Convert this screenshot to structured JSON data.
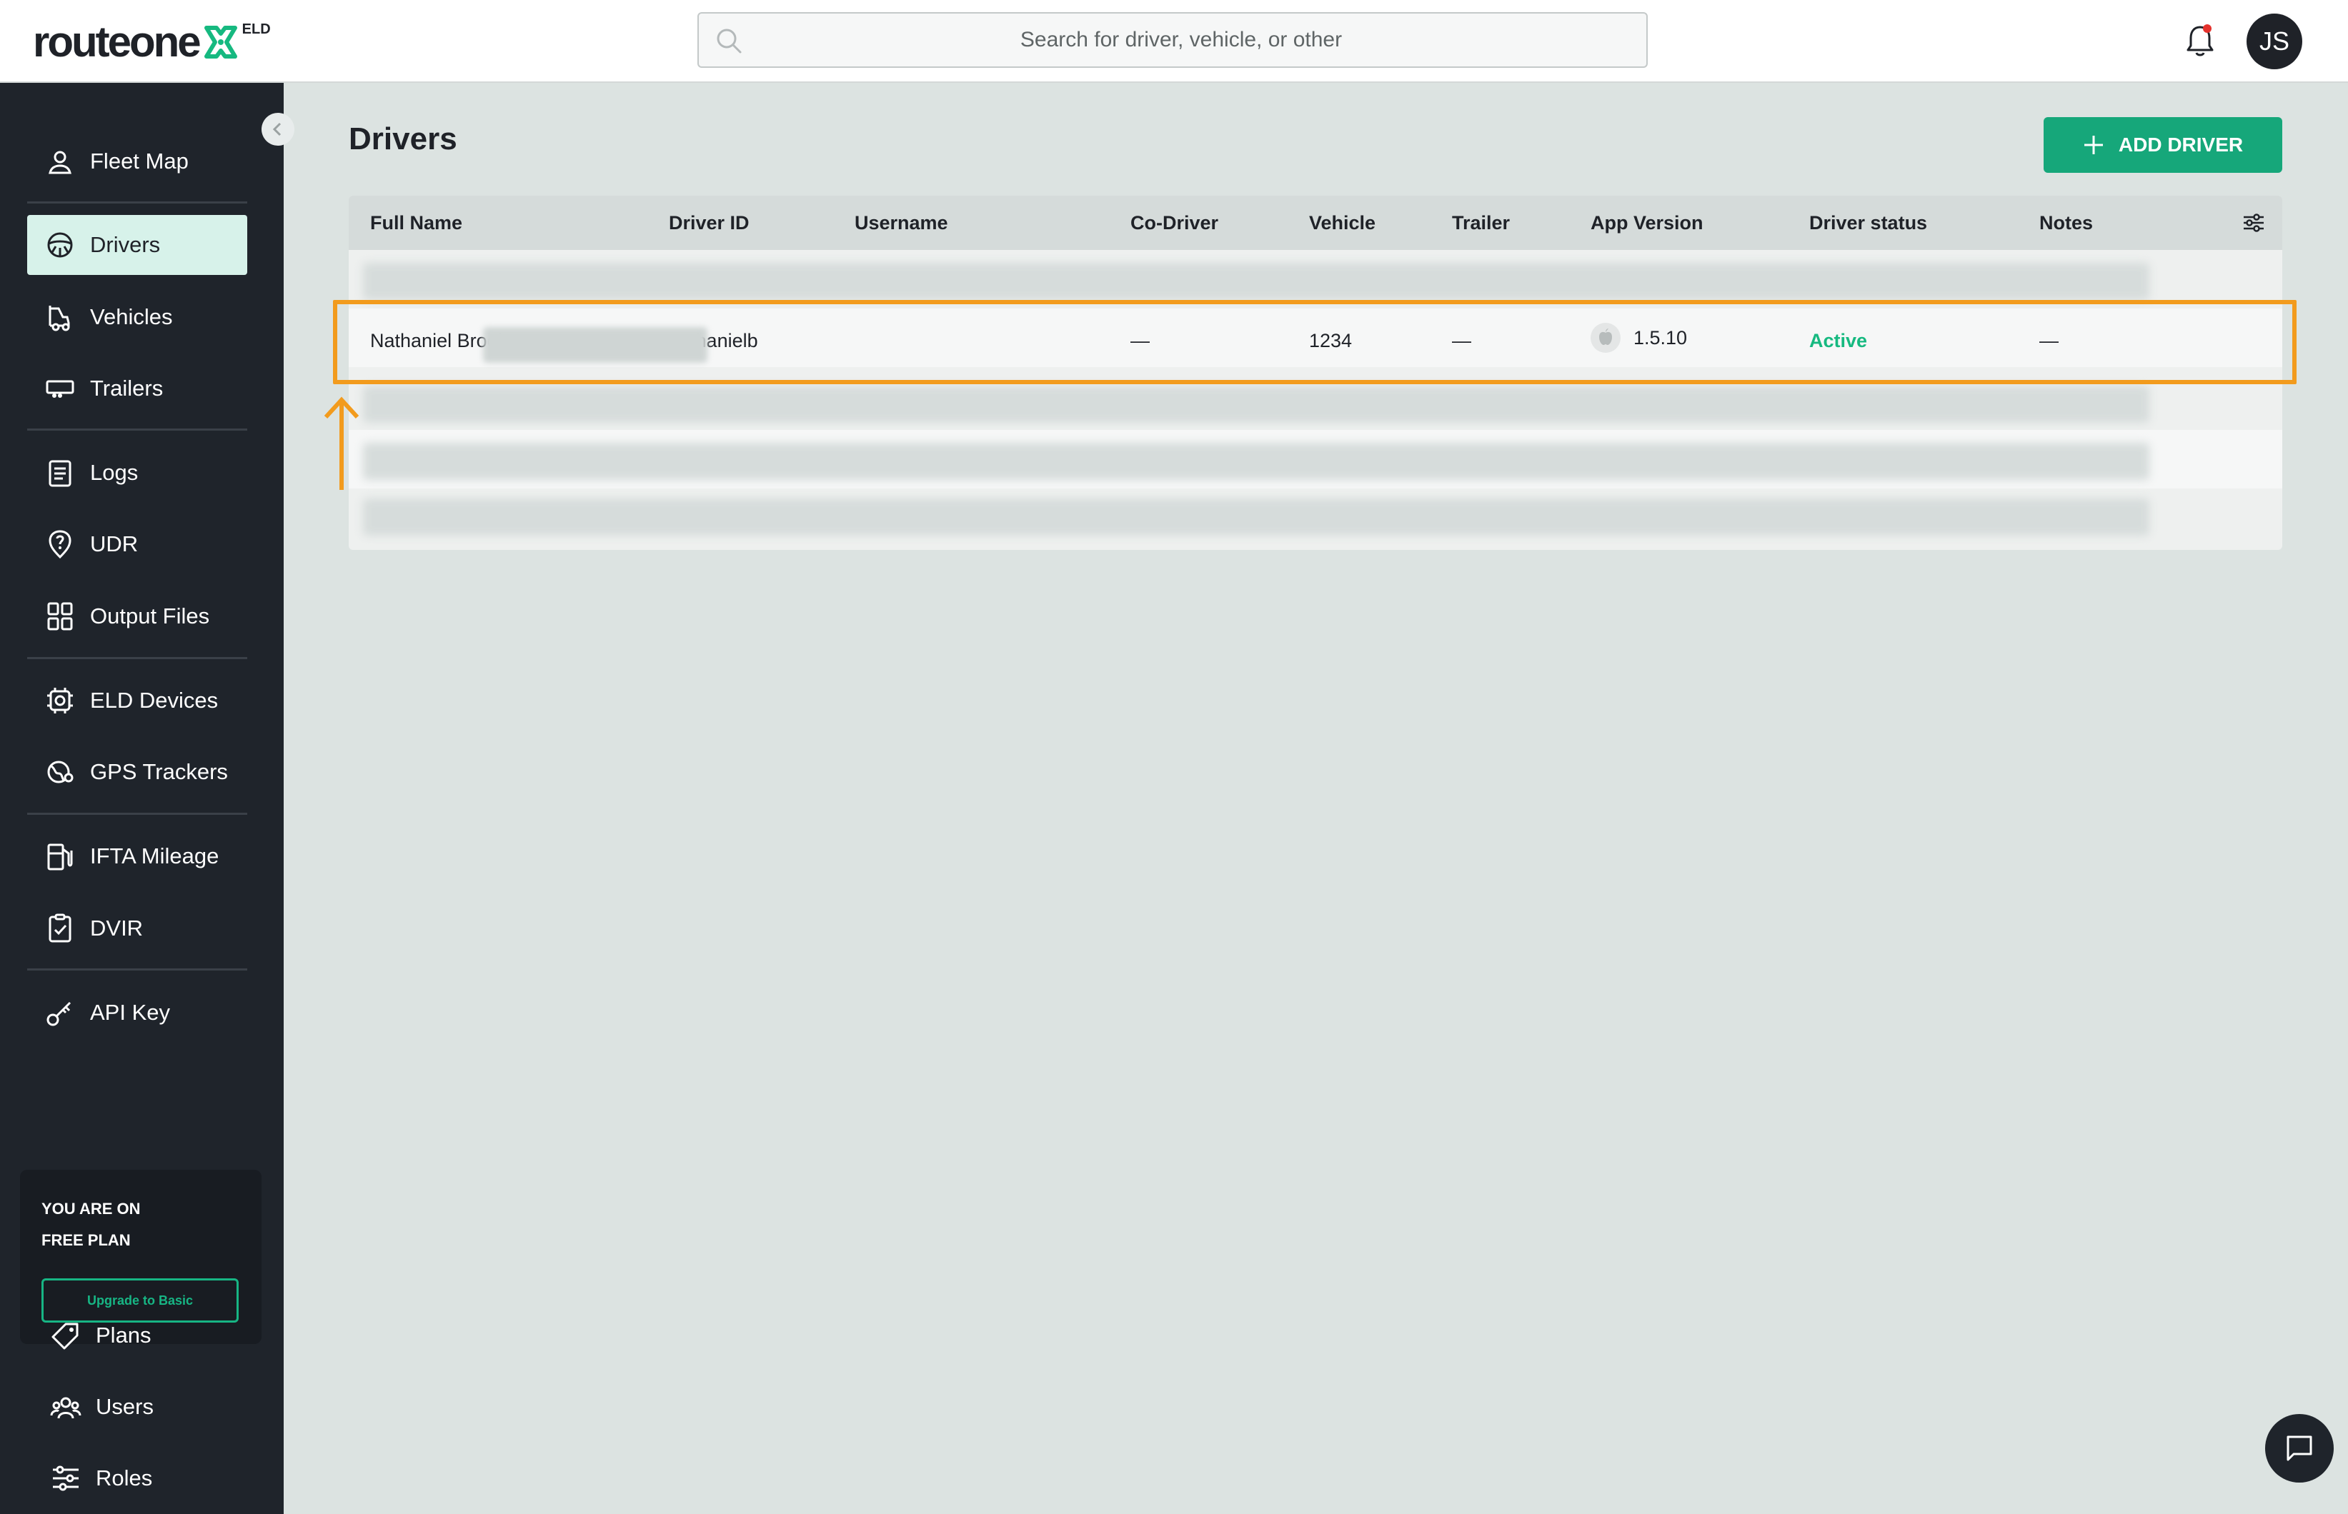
{
  "header": {
    "logo_text": "routeone",
    "logo_badge": "ELD",
    "search_placeholder": "Search for driver, vehicle, or other",
    "avatar_initials": "JS",
    "notification_dot_color": "#e5322d"
  },
  "sidebar": {
    "items": [
      {
        "label": "Fleet Map",
        "icon": "map-pin-icon"
      },
      {
        "label": "Drivers",
        "icon": "steering-wheel-icon",
        "active": true
      },
      {
        "label": "Vehicles",
        "icon": "truck-icon"
      },
      {
        "label": "Trailers",
        "icon": "trailer-icon"
      },
      {
        "label": "Logs",
        "icon": "clipboard-list-icon"
      },
      {
        "label": "UDR",
        "icon": "location-question-icon"
      },
      {
        "label": "Output Files",
        "icon": "grid-files-icon"
      },
      {
        "label": "ELD Devices",
        "icon": "device-chip-icon"
      },
      {
        "label": "GPS Trackers",
        "icon": "gps-tracker-icon"
      },
      {
        "label": "IFTA Mileage",
        "icon": "fuel-pump-icon"
      },
      {
        "label": "DVIR",
        "icon": "checklist-icon"
      },
      {
        "label": "API Key",
        "icon": "key-icon"
      },
      {
        "label": "Plans",
        "icon": "tag-icon"
      },
      {
        "label": "Users",
        "icon": "users-icon"
      },
      {
        "label": "Roles",
        "icon": "sliders-icon"
      }
    ],
    "plan": {
      "line1": "YOU ARE ON",
      "line2": "FREE PLAN",
      "upgrade_label": "Upgrade to Basic"
    }
  },
  "main": {
    "title": "Drivers",
    "add_button_label": "ADD DRIVER",
    "table": {
      "columns": [
        "Full Name",
        "Driver ID",
        "Username",
        "Co-Driver",
        "Vehicle",
        "Trailer",
        "App Version",
        "Driver status",
        "Notes"
      ],
      "highlighted_row": {
        "full_name": "Nathaniel Brooks",
        "driver_id": "nathanielb",
        "co_driver": "—",
        "vehicle": "1234",
        "trailer": "—",
        "app_version": "1.5.10",
        "driver_status": "Active",
        "notes": "—"
      }
    }
  },
  "colors": {
    "accent": "#16a77a",
    "status_active": "#16b980",
    "highlight": "#f29b1d",
    "sidebar_bg": "#1f242b"
  }
}
